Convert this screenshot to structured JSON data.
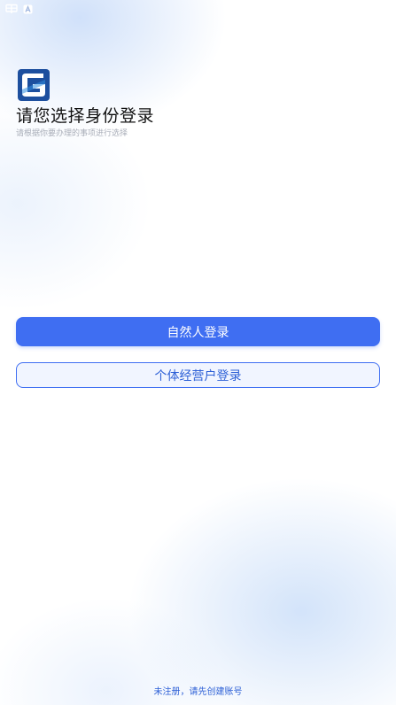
{
  "status_bar": {
    "icons": [
      "carrier-icon",
      "a-badge-icon"
    ]
  },
  "header": {
    "logo_icon": "g-logo-icon",
    "title": "请您选择身份登录",
    "subtitle": "请根据你要办理的事项进行选择"
  },
  "actions": {
    "primary_label": "自然人登录",
    "secondary_label": "个体经营户登录"
  },
  "footer": {
    "register_text": "未注册，请先创建账号"
  },
  "colors": {
    "accent": "#3f6ef2",
    "link": "#2c5fd6",
    "logo_blue": "#2f8ee0",
    "logo_dark": "#1d4f9e"
  }
}
